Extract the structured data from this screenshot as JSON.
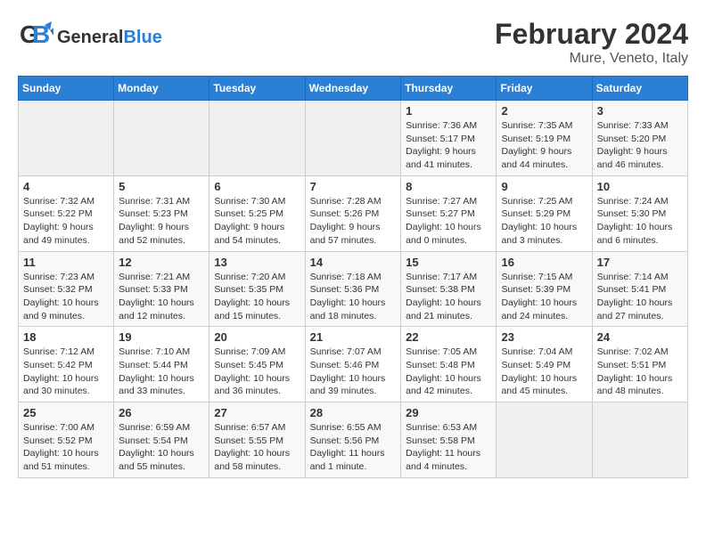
{
  "header": {
    "logo_general": "General",
    "logo_blue": "Blue",
    "month_year": "February 2024",
    "location": "Mure, Veneto, Italy"
  },
  "weekdays": [
    "Sunday",
    "Monday",
    "Tuesday",
    "Wednesday",
    "Thursday",
    "Friday",
    "Saturday"
  ],
  "weeks": [
    [
      {
        "day": "",
        "info": ""
      },
      {
        "day": "",
        "info": ""
      },
      {
        "day": "",
        "info": ""
      },
      {
        "day": "",
        "info": ""
      },
      {
        "day": "1",
        "info": "Sunrise: 7:36 AM\nSunset: 5:17 PM\nDaylight: 9 hours\nand 41 minutes."
      },
      {
        "day": "2",
        "info": "Sunrise: 7:35 AM\nSunset: 5:19 PM\nDaylight: 9 hours\nand 44 minutes."
      },
      {
        "day": "3",
        "info": "Sunrise: 7:33 AM\nSunset: 5:20 PM\nDaylight: 9 hours\nand 46 minutes."
      }
    ],
    [
      {
        "day": "4",
        "info": "Sunrise: 7:32 AM\nSunset: 5:22 PM\nDaylight: 9 hours\nand 49 minutes."
      },
      {
        "day": "5",
        "info": "Sunrise: 7:31 AM\nSunset: 5:23 PM\nDaylight: 9 hours\nand 52 minutes."
      },
      {
        "day": "6",
        "info": "Sunrise: 7:30 AM\nSunset: 5:25 PM\nDaylight: 9 hours\nand 54 minutes."
      },
      {
        "day": "7",
        "info": "Sunrise: 7:28 AM\nSunset: 5:26 PM\nDaylight: 9 hours\nand 57 minutes."
      },
      {
        "day": "8",
        "info": "Sunrise: 7:27 AM\nSunset: 5:27 PM\nDaylight: 10 hours\nand 0 minutes."
      },
      {
        "day": "9",
        "info": "Sunrise: 7:25 AM\nSunset: 5:29 PM\nDaylight: 10 hours\nand 3 minutes."
      },
      {
        "day": "10",
        "info": "Sunrise: 7:24 AM\nSunset: 5:30 PM\nDaylight: 10 hours\nand 6 minutes."
      }
    ],
    [
      {
        "day": "11",
        "info": "Sunrise: 7:23 AM\nSunset: 5:32 PM\nDaylight: 10 hours\nand 9 minutes."
      },
      {
        "day": "12",
        "info": "Sunrise: 7:21 AM\nSunset: 5:33 PM\nDaylight: 10 hours\nand 12 minutes."
      },
      {
        "day": "13",
        "info": "Sunrise: 7:20 AM\nSunset: 5:35 PM\nDaylight: 10 hours\nand 15 minutes."
      },
      {
        "day": "14",
        "info": "Sunrise: 7:18 AM\nSunset: 5:36 PM\nDaylight: 10 hours\nand 18 minutes."
      },
      {
        "day": "15",
        "info": "Sunrise: 7:17 AM\nSunset: 5:38 PM\nDaylight: 10 hours\nand 21 minutes."
      },
      {
        "day": "16",
        "info": "Sunrise: 7:15 AM\nSunset: 5:39 PM\nDaylight: 10 hours\nand 24 minutes."
      },
      {
        "day": "17",
        "info": "Sunrise: 7:14 AM\nSunset: 5:41 PM\nDaylight: 10 hours\nand 27 minutes."
      }
    ],
    [
      {
        "day": "18",
        "info": "Sunrise: 7:12 AM\nSunset: 5:42 PM\nDaylight: 10 hours\nand 30 minutes."
      },
      {
        "day": "19",
        "info": "Sunrise: 7:10 AM\nSunset: 5:44 PM\nDaylight: 10 hours\nand 33 minutes."
      },
      {
        "day": "20",
        "info": "Sunrise: 7:09 AM\nSunset: 5:45 PM\nDaylight: 10 hours\nand 36 minutes."
      },
      {
        "day": "21",
        "info": "Sunrise: 7:07 AM\nSunset: 5:46 PM\nDaylight: 10 hours\nand 39 minutes."
      },
      {
        "day": "22",
        "info": "Sunrise: 7:05 AM\nSunset: 5:48 PM\nDaylight: 10 hours\nand 42 minutes."
      },
      {
        "day": "23",
        "info": "Sunrise: 7:04 AM\nSunset: 5:49 PM\nDaylight: 10 hours\nand 45 minutes."
      },
      {
        "day": "24",
        "info": "Sunrise: 7:02 AM\nSunset: 5:51 PM\nDaylight: 10 hours\nand 48 minutes."
      }
    ],
    [
      {
        "day": "25",
        "info": "Sunrise: 7:00 AM\nSunset: 5:52 PM\nDaylight: 10 hours\nand 51 minutes."
      },
      {
        "day": "26",
        "info": "Sunrise: 6:59 AM\nSunset: 5:54 PM\nDaylight: 10 hours\nand 55 minutes."
      },
      {
        "day": "27",
        "info": "Sunrise: 6:57 AM\nSunset: 5:55 PM\nDaylight: 10 hours\nand 58 minutes."
      },
      {
        "day": "28",
        "info": "Sunrise: 6:55 AM\nSunset: 5:56 PM\nDaylight: 11 hours\nand 1 minute."
      },
      {
        "day": "29",
        "info": "Sunrise: 6:53 AM\nSunset: 5:58 PM\nDaylight: 11 hours\nand 4 minutes."
      },
      {
        "day": "",
        "info": ""
      },
      {
        "day": "",
        "info": ""
      }
    ]
  ]
}
